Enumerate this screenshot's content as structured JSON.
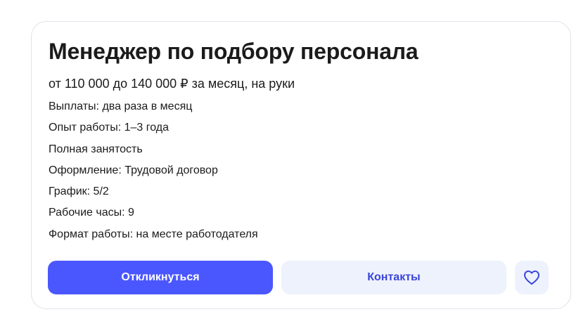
{
  "vacancy": {
    "title": "Менеджер по подбору персонала",
    "salary": "от 110 000 до 140 000 ₽ за месяц, на руки",
    "details": [
      "Выплаты: два раза в месяц",
      "Опыт работы: 1–3 года",
      "Полная занятость",
      "Оформление: Трудовой договор",
      "График: 5/2",
      "Рабочие часы: 9",
      "Формат работы: на месте работодателя"
    ]
  },
  "actions": {
    "apply_label": "Откликнуться",
    "contacts_label": "Контакты",
    "favorite_icon": "heart-icon"
  },
  "colors": {
    "primary": "#4a57ff",
    "secondary_bg": "#eef2fd",
    "secondary_text": "#3a46d9",
    "text": "#1b1b1b",
    "border": "#dfe3ea"
  }
}
